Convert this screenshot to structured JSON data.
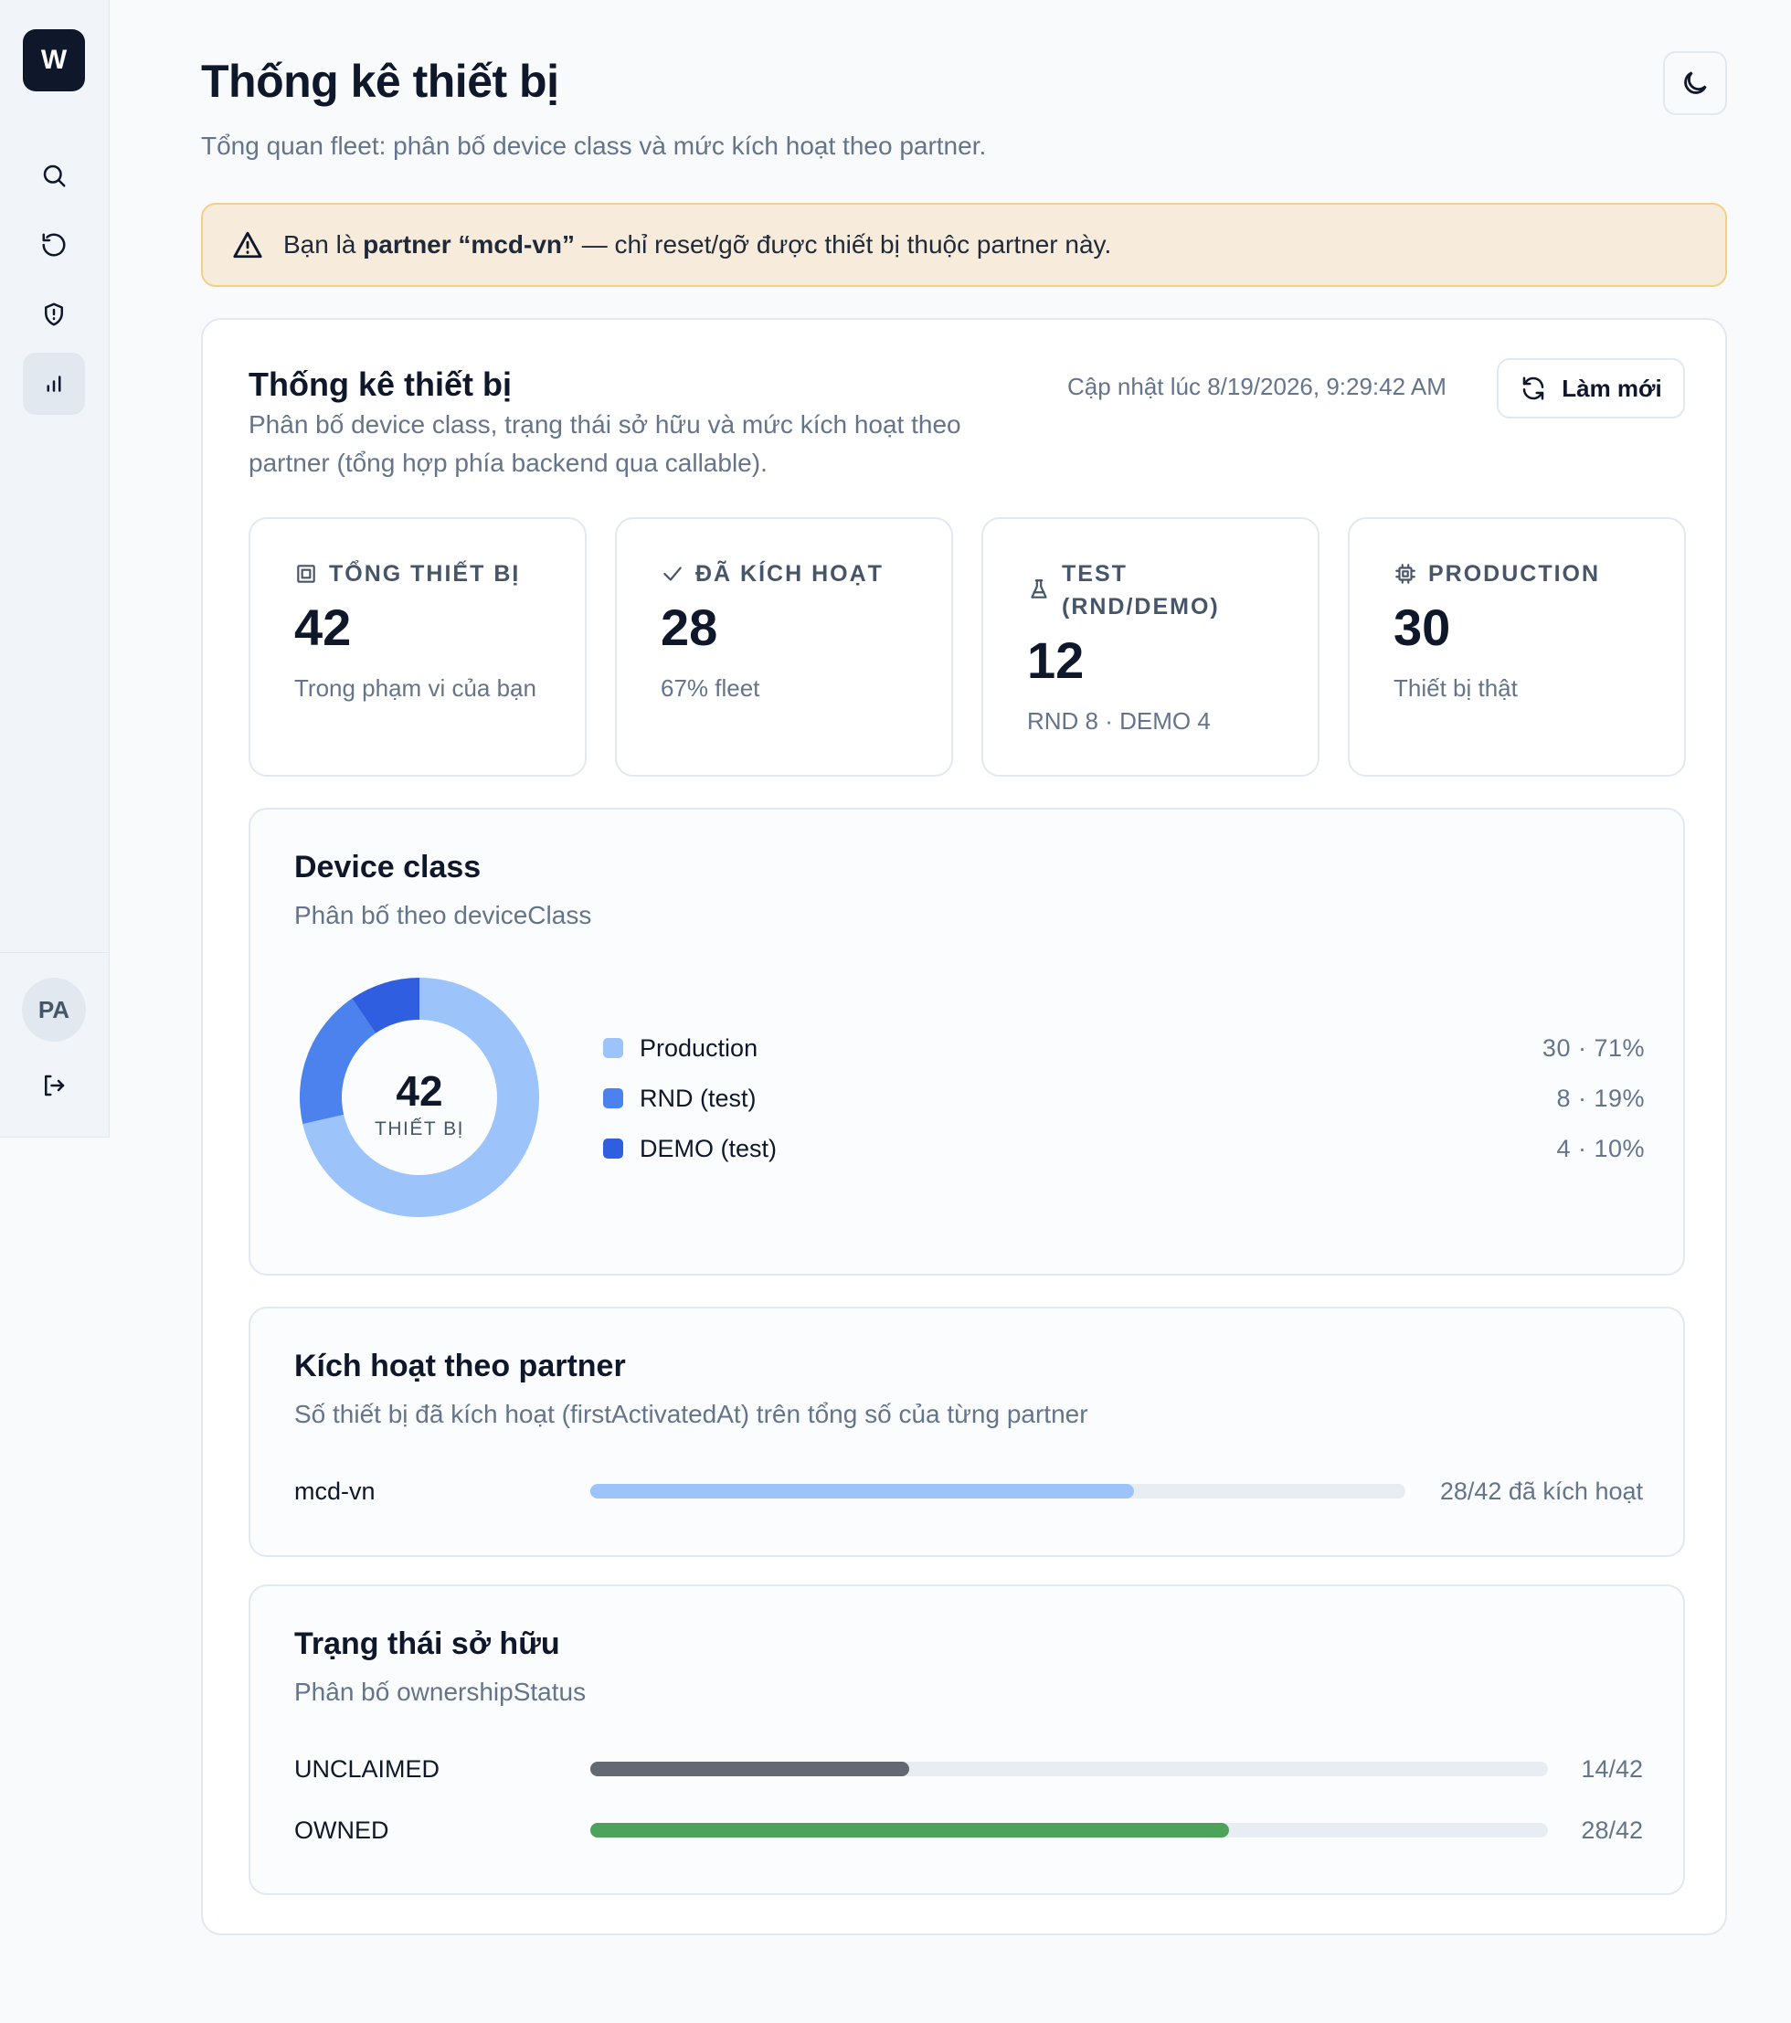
{
  "sidebar": {
    "logo": "W",
    "items": [
      {
        "icon": "search-icon"
      },
      {
        "icon": "reset-icon"
      },
      {
        "icon": "shield-icon"
      },
      {
        "icon": "bar-chart-icon",
        "active": true
      }
    ],
    "avatar": "PA",
    "logout_icon": "logout-icon"
  },
  "header": {
    "title": "Thống kê thiết bị",
    "subtitle": "Tổng quan fleet: phân bố device class và mức kích hoạt theo partner.",
    "theme_icon": "moon-icon"
  },
  "alert": {
    "prefix": "Bạn là ",
    "bold": "partner “mcd-vn”",
    "suffix": " — chỉ reset/gỡ được thiết bị thuộc partner này."
  },
  "card": {
    "title": "Thống kê thiết bị",
    "description": "Phân bố device class, trạng thái sở hữu và mức kích hoạt theo partner (tổng hợp phía backend qua callable).",
    "updated": "Cập nhật lúc 8/19/2026, 9:29:42 AM",
    "refresh_label": "Làm mới"
  },
  "stats": [
    {
      "icon": "device-icon",
      "label": "TỔNG THIẾT BỊ",
      "value": "42",
      "note": "Trong phạm vi của bạn"
    },
    {
      "icon": "check-icon",
      "label": "ĐÃ KÍCH HOẠT",
      "value": "28",
      "note": "67% fleet"
    },
    {
      "icon": "flask-icon",
      "label": "TEST (RND/DEMO)",
      "value": "12",
      "note": "RND 8 · DEMO 4"
    },
    {
      "icon": "chip-icon",
      "label": "PRODUCTION",
      "value": "30",
      "note": "Thiết bị thật"
    }
  ],
  "device_class": {
    "title": "Device class",
    "subtitle": "Phân bố theo deviceClass",
    "center_value": "42",
    "center_label": "THIẾT BỊ"
  },
  "partner_activation": {
    "title": "Kích hoạt theo partner",
    "subtitle": "Số thiết bị đã kích hoạt (firstActivatedAt) trên tổng số của từng partner",
    "rows": [
      {
        "label": "mcd-vn",
        "activated": 28,
        "total": 42,
        "text": "28/42 đã kích hoạt",
        "color": "#9cc3fa"
      }
    ]
  },
  "ownership": {
    "title": "Trạng thái sở hữu",
    "subtitle": "Phân bố ownershipStatus",
    "rows": [
      {
        "label": "UNCLAIMED",
        "count": 14,
        "total": 42,
        "text": "14/42",
        "color": "#636873"
      },
      {
        "label": "OWNED",
        "count": 28,
        "total": 42,
        "text": "28/42",
        "color": "#4ea35a"
      }
    ]
  },
  "chart_data": {
    "type": "pie",
    "categories": [
      "Production",
      "RND (test)",
      "DEMO (test)"
    ],
    "values": [
      30,
      8,
      4
    ],
    "value_labels": [
      "30 · 71%",
      "8 · 19%",
      "4 · 10%"
    ],
    "colors": [
      "#9cc3fa",
      "#4b82ee",
      "#2f5fe0"
    ]
  }
}
